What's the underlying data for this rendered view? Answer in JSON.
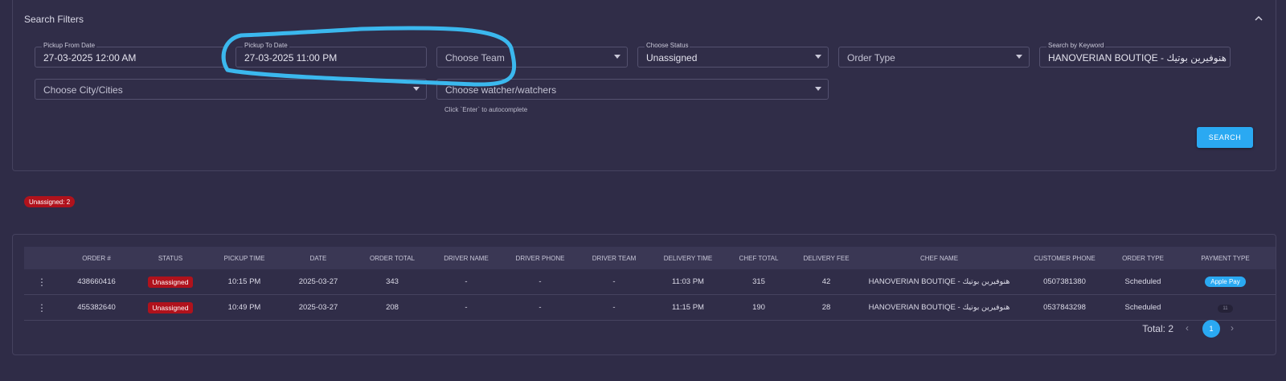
{
  "filters": {
    "title": "Search Filters",
    "pickup_from": {
      "label": "Pickup From Date",
      "value": "27-03-2025 12:00 AM"
    },
    "pickup_to": {
      "label": "Pickup To Date",
      "value": "27-03-2025 11:00 PM"
    },
    "team": {
      "placeholder": "Choose Team"
    },
    "status": {
      "label": "Choose Status",
      "value": "Unassigned"
    },
    "order_type": {
      "placeholder": "Order Type"
    },
    "keyword": {
      "label": "Search by Keyword",
      "value": "HANOVERIAN BOUTIQE - هنوفيرين بوتيك"
    },
    "city": {
      "placeholder": "Choose City/Cities"
    },
    "watcher": {
      "placeholder": "Choose watcher/watchers"
    },
    "hint": "Click `Enter` to autocomplete",
    "search_label": "SEARCH"
  },
  "summary": {
    "badge": "Unassigned: 2"
  },
  "table": {
    "headers": [
      "ORDER #",
      "STATUS",
      "PICKUP TIME",
      "DATE",
      "ORDER TOTAL",
      "DRIVER NAME",
      "DRIVER PHONE",
      "DRIVER TEAM",
      "DELIVERY TIME",
      "CHEF TOTAL",
      "DELIVERY FEE",
      "CHEF NAME",
      "CUSTOMER PHONE",
      "ORDER TYPE",
      "PAYMENT TYPE"
    ],
    "rows": [
      {
        "order": "438660416",
        "status": "Unassigned",
        "pickup_time": "10:15 PM",
        "date": "2025-03-27",
        "order_total": "343",
        "driver_name": "-",
        "driver_phone": "-",
        "driver_team": "-",
        "delivery_time": "11:03 PM",
        "chef_total": "315",
        "delivery_fee": "42",
        "chef_name": "HANOVERIAN BOUTIQE - هنوفيرين بوتيك",
        "customer_phone": "0507381380",
        "order_type": "Scheduled",
        "payment_type": "Apple Pay"
      },
      {
        "order": "455382640",
        "status": "Unassigned",
        "pickup_time": "10:49 PM",
        "date": "2025-03-27",
        "order_total": "208",
        "driver_name": "-",
        "driver_phone": "-",
        "driver_team": "-",
        "delivery_time": "11:15 PM",
        "chef_total": "190",
        "delivery_fee": "28",
        "chef_name": "HANOVERIAN BOUTIQE - هنوفيرين بوتيك",
        "customer_phone": "0537843298",
        "order_type": "Scheduled",
        "payment_type": "11"
      }
    ]
  },
  "pagination": {
    "total": "Total: 2",
    "current_page": "1"
  },
  "colors": {
    "accent": "#2aa9f2",
    "status_red": "#b0121c",
    "background": "#2f2c47",
    "annotation": "#3bb8ee"
  },
  "icons": {
    "collapse": "chevron-up-icon",
    "row_menu": "kebab-icon",
    "prev": "chevron-left-icon",
    "next": "chevron-right-icon"
  }
}
